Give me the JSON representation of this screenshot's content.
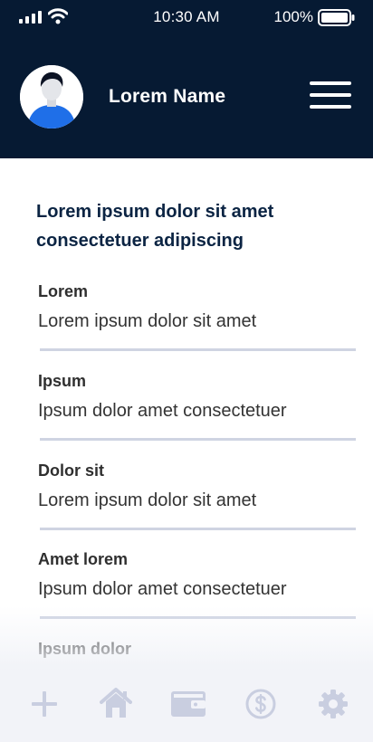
{
  "status_bar": {
    "time": "10:30 AM",
    "battery": "100%",
    "icons": [
      "signal-icon",
      "wifi-icon",
      "battery-icon"
    ]
  },
  "header": {
    "name": "Lorem Name",
    "avatar": "avatar-icon",
    "menu": "hamburger-menu-icon",
    "background_color": "#061a33"
  },
  "content": {
    "title": "Lorem ipsum dolor sit amet consectetuer adipiscing",
    "fields": [
      {
        "label": "Lorem",
        "value": "Lorem ipsum dolor sit amet"
      },
      {
        "label": "Ipsum",
        "value": "Ipsum dolor amet consectetuer"
      },
      {
        "label": "Dolor sit",
        "value": "Lorem ipsum dolor sit amet"
      },
      {
        "label": "Amet lorem",
        "value": "Ipsum dolor amet consectetuer"
      },
      {
        "label": "Ipsum dolor",
        "value": ""
      }
    ]
  },
  "tab_bar": {
    "icons": [
      "plus-icon",
      "home-icon",
      "wallet-icon",
      "dollar-icon",
      "gear-icon"
    ],
    "icon_color": "#c9cee0"
  }
}
